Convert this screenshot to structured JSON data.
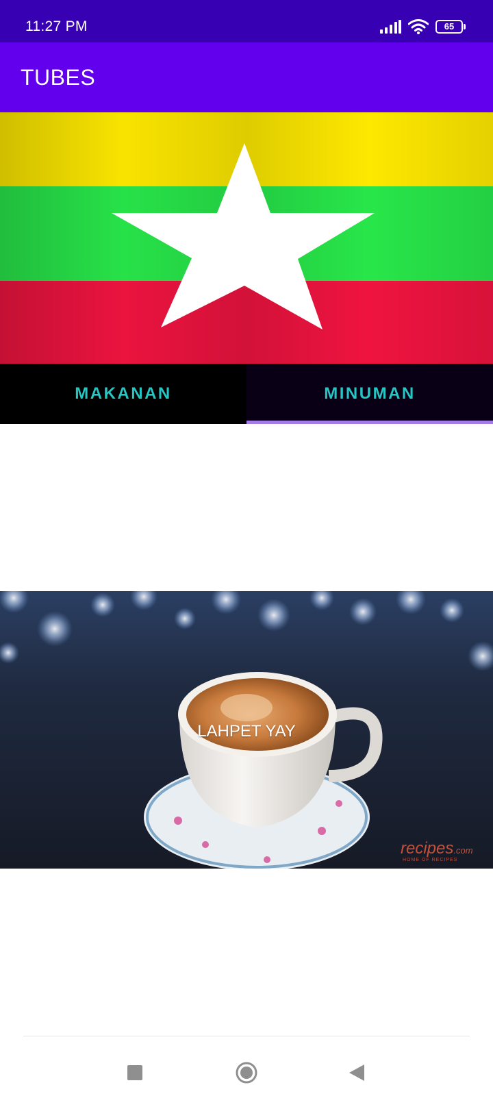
{
  "status_bar": {
    "time": "11:27 PM",
    "battery_level": "65",
    "icons": [
      "signal-icon",
      "wifi-icon",
      "battery-icon"
    ]
  },
  "app_bar": {
    "title": "TUBES"
  },
  "header_image": {
    "subject": "flag",
    "colors": [
      "#fde800",
      "#28e64a",
      "#ef1440",
      "#ffffff"
    ]
  },
  "tabs": [
    {
      "label": "MAKANAN",
      "selected": false
    },
    {
      "label": "MINUMAN",
      "selected": true
    }
  ],
  "tab_colors": {
    "label": "#25c6c3",
    "indicator": "#a37ce6"
  },
  "drink_item": {
    "name": "LAHPET YAY",
    "watermark": "recipes",
    "watermark_sub": "HOME OF RECIPES",
    "watermark_suffix": ".com"
  },
  "nav_bar": {
    "buttons": [
      "recents-button",
      "home-button",
      "back-button"
    ]
  }
}
